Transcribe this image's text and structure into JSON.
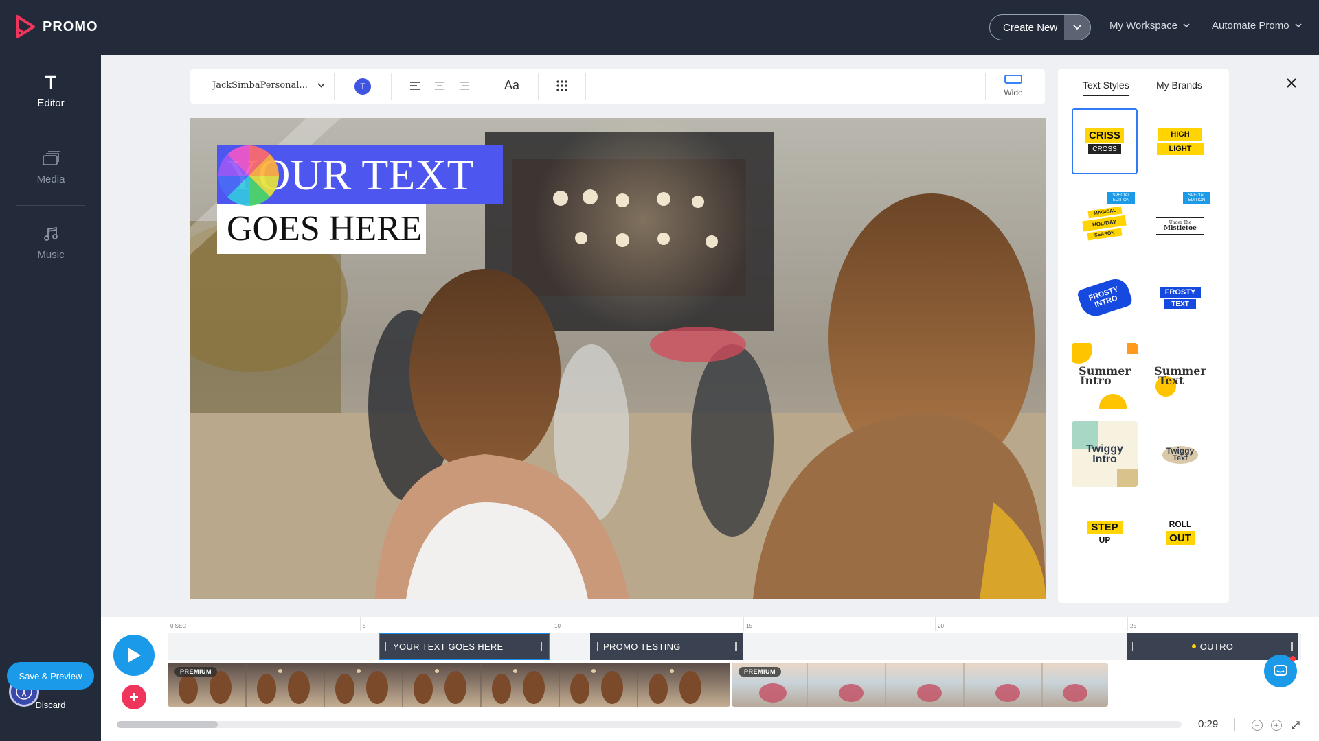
{
  "app": {
    "brand": "PROMO"
  },
  "header": {
    "create_new": "Create New",
    "menus": [
      "My Workspace",
      "Automate Promo"
    ]
  },
  "sidebar": {
    "items": [
      {
        "label": "Editor",
        "icon": "text-t-icon",
        "active": true
      },
      {
        "label": "Media",
        "icon": "media-stack-icon",
        "active": false
      },
      {
        "label": "Music",
        "icon": "music-note-icon",
        "active": false
      }
    ],
    "save_preview": "Save & Preview",
    "discard": "Discard"
  },
  "toolbar": {
    "font_name": "JackSimbaPersonal...",
    "color_letter": "T",
    "text_size_label": "Aa",
    "aspect_label": "Wide"
  },
  "canvas": {
    "line1": "YOUR TEXT",
    "line2": "GOES HERE"
  },
  "right_panel": {
    "tabs": [
      "Text Styles",
      "My Brands"
    ],
    "styles": [
      {
        "t1": "CRISS",
        "t2": "CROSS"
      },
      {
        "t1": "HIGH",
        "t2": "LIGHT"
      },
      {
        "t1": "MAGICAL",
        "t2": "HOLIDAY",
        "t3": "SEASON",
        "badge": "SPECIAL EDITION"
      },
      {
        "t1": "Under The",
        "t2": "Mistletoe",
        "badge": "SPECIAL EDITION"
      },
      {
        "t1": "FROSTY",
        "t2": "INTRO"
      },
      {
        "t1": "FROSTY",
        "t2": "TEXT"
      },
      {
        "t1": "Summer",
        "t2": "Intro"
      },
      {
        "t1": "Summer",
        "t2": "Text"
      },
      {
        "t1": "Twiggy",
        "t2": "Intro"
      },
      {
        "t1": "Twiggy",
        "t2": "Text"
      },
      {
        "t1": "STEP",
        "t2": "UP"
      },
      {
        "t1": "ROLL",
        "t2": "OUT"
      }
    ]
  },
  "timeline": {
    "ticks": [
      "0 SEC",
      "5",
      "10",
      "15",
      "20",
      "25"
    ],
    "clips": [
      "YOUR TEXT GOES HERE",
      "PROMO TESTING",
      "OUTRO"
    ],
    "premium_label": "PREMIUM",
    "duration": "0:29"
  },
  "colors": {
    "dark": "#232b3b",
    "accent_blue": "#1a9ae8",
    "text_bg": "#4e56f0",
    "add_red": "#f0355d"
  }
}
